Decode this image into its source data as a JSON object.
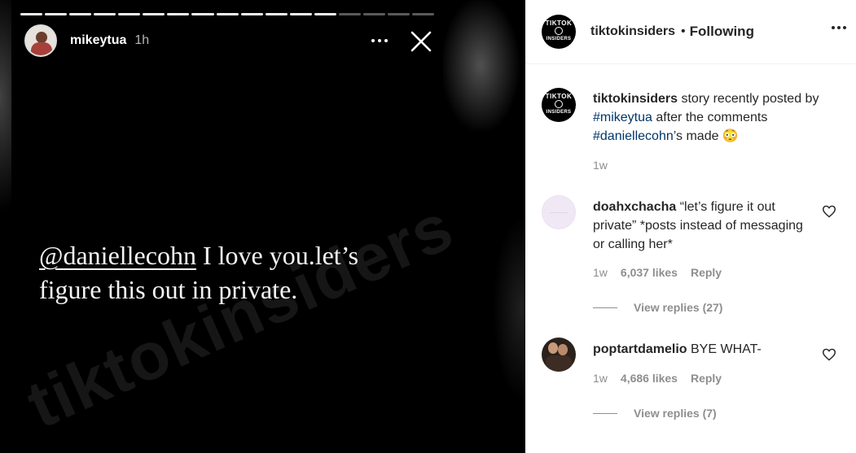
{
  "story": {
    "progress_segments_total": 17,
    "progress_segments_done": 13,
    "username": "mikeytua",
    "time": "1h",
    "mention": "@daniellecohn",
    "text_line1_rest": " I love you.let’s",
    "text_line2": "figure this out in private.",
    "watermark": "tiktokinsiders",
    "more_icon": "ellipsis-icon",
    "close_icon": "close-icon"
  },
  "post": {
    "username": "tiktokinsiders",
    "separator": "•",
    "follow_label": "Following",
    "avatar_top": "TIKTOK",
    "avatar_bottom": "INSIDERS",
    "caption": {
      "username": "tiktokinsiders",
      "text1": " story recently posted by ",
      "hashtag1": "#mikeytua",
      "text2": " after the comments ",
      "hashtag2": "#daniellecohn",
      "text3": "’s made 😳",
      "time": "1w"
    },
    "comments": [
      {
        "username": "doahxchacha",
        "text": " “let’s figure it out private” *posts instead of messaging or calling her*",
        "time": "1w",
        "likes": "6,037 likes",
        "reply_label": "Reply",
        "view_replies": "View replies (27)"
      },
      {
        "username": "poptartdamelio",
        "text": " BYE WHAT-",
        "time": "1w",
        "likes": "4,686 likes",
        "reply_label": "Reply",
        "view_replies": "View replies (7)"
      }
    ]
  },
  "colors": {
    "hashtag": "#00376b",
    "meta_gray": "#8e8e8e",
    "text": "#262626"
  }
}
